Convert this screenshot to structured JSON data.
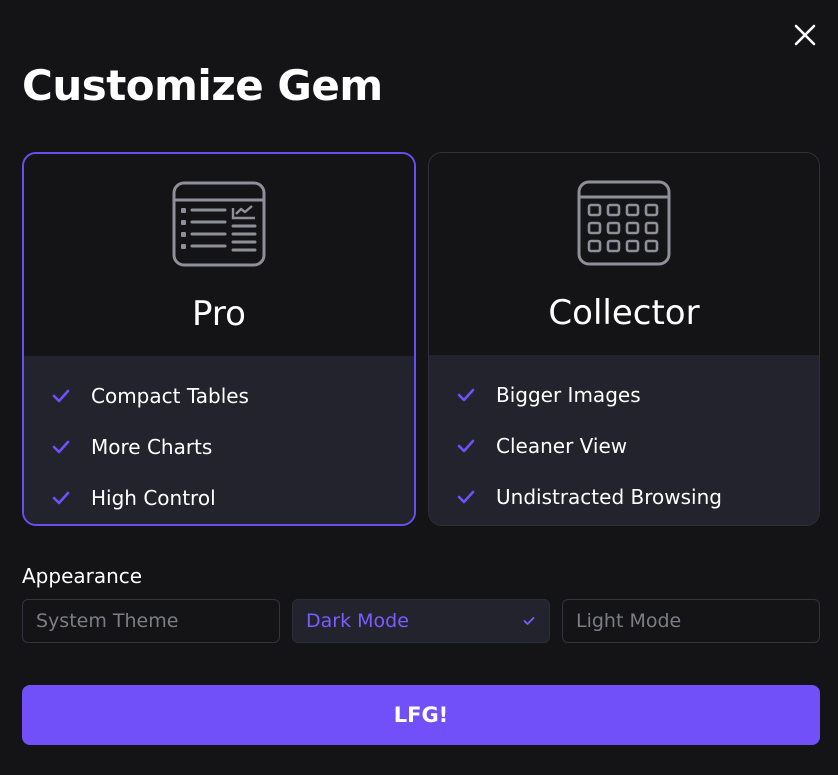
{
  "title": "Customize Gem",
  "close_icon": "close-icon",
  "cards": [
    {
      "title": "Pro",
      "icon": "table-chart-icon",
      "selected": true,
      "features": [
        "Compact Tables",
        "More Charts",
        "High Control"
      ]
    },
    {
      "title": "Collector",
      "icon": "grid-icon",
      "selected": false,
      "features": [
        "Bigger Images",
        "Cleaner View",
        "Undistracted Browsing"
      ]
    }
  ],
  "appearance": {
    "label": "Appearance",
    "options": [
      "System Theme",
      "Dark Mode",
      "Light Mode"
    ],
    "selected": "Dark Mode"
  },
  "cta_label": "LFG!",
  "colors": {
    "accent": "#7150fa",
    "selected_border": "#6b4ef0",
    "background": "#141417",
    "panel": "#22232d"
  }
}
